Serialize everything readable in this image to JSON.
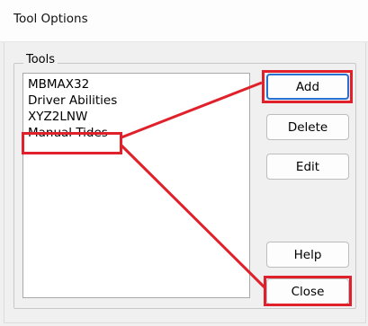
{
  "window": {
    "title": "Tool Options"
  },
  "tools_group": {
    "label": "Tools",
    "items": [
      "MBMAX32",
      "Driver Abilities",
      "XYZ2LNW",
      "Manual Tides"
    ]
  },
  "buttons": {
    "add": "Add",
    "delete": "Delete",
    "edit": "Edit",
    "help": "Help",
    "close": "Close"
  },
  "colors": {
    "annotation_red": "#e0202a",
    "focus_blue": "#2b6fcf",
    "dialog_background": "#f0f0f0"
  }
}
